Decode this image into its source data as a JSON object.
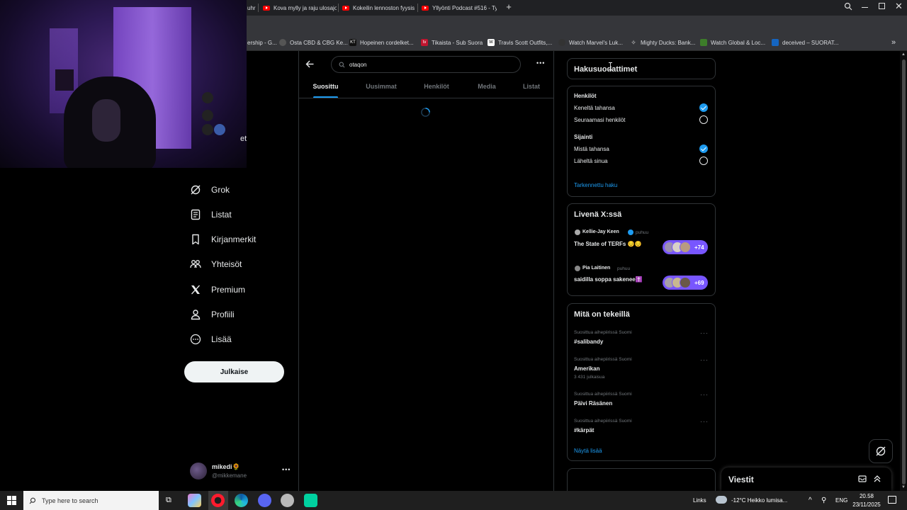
{
  "browser": {
    "tabs": [
      {
        "label": "uhr"
      },
      {
        "label": "Kova mylly ja raju ulosajo"
      },
      {
        "label": "Kokeilin lennoston fyysis"
      },
      {
        "label": "Yllyönti Podcast #516 - Ty"
      }
    ],
    "new_tab_icon": "plus-icon",
    "bookmarks": [
      {
        "label": "ership - G..."
      },
      {
        "label": "Osta CBD & CBG Ke..."
      },
      {
        "label": "Hopeinen cordelket..."
      },
      {
        "label": "Tikaista - Sub Suora"
      },
      {
        "label": "Travis Scott Outfits,..."
      },
      {
        "label": "Watch Marvel's Luk..."
      },
      {
        "label": "Mighty Ducks: Bank..."
      },
      {
        "label": "Watch Global & Loc..."
      },
      {
        "label": "deceived – SUORAT..."
      }
    ]
  },
  "webcam": {
    "partial_text": "et"
  },
  "nav": {
    "items": [
      {
        "label": "Grok",
        "icon": "grok-icon"
      },
      {
        "label": "Listat",
        "icon": "list-icon"
      },
      {
        "label": "Kirjanmerkit",
        "icon": "bookmark-icon"
      },
      {
        "label": "Yhteisöt",
        "icon": "communities-icon"
      },
      {
        "label": "Premium",
        "icon": "x-logo-icon"
      },
      {
        "label": "Profiili",
        "icon": "profile-icon"
      },
      {
        "label": "Lisää",
        "icon": "more-circle-icon"
      }
    ],
    "publish_label": "Julkaise",
    "account": {
      "name": "mikedi🌻",
      "handle": "@mikkemane"
    }
  },
  "center": {
    "search_value": "otaqon",
    "tabs": [
      {
        "label": "Suosittu",
        "active": true
      },
      {
        "label": "Uusimmat",
        "active": false
      },
      {
        "label": "Henkilöt",
        "active": false
      },
      {
        "label": "Media",
        "active": false
      },
      {
        "label": "Listat",
        "active": false
      }
    ]
  },
  "filters": {
    "title": "Hakusuodattimet",
    "people_heading": "Henkilöt",
    "people_options": [
      {
        "label": "Keneltä tahansa",
        "selected": true
      },
      {
        "label": "Seuraamasi henkilöt",
        "selected": false
      }
    ],
    "location_heading": "Sijainti",
    "location_options": [
      {
        "label": "Mistä tahansa",
        "selected": true
      },
      {
        "label": "Läheltä sinua",
        "selected": false
      }
    ],
    "advanced_link": "Tarkennettu haku"
  },
  "live": {
    "title": "Livenä X:ssä",
    "spaces": [
      {
        "host": "Kellie-Jay Keen",
        "verb": "puhuu",
        "title": "The State of TERFs 😔😔",
        "count": "+74"
      },
      {
        "host": "Pia Laitinen",
        "verb": "puhuu",
        "title": "saidilla soppa sakenee✝️",
        "count": "+69"
      }
    ]
  },
  "trends": {
    "title": "Mitä on tekeillä",
    "items": [
      {
        "context": "Suosittua aihepiirissä Suomi",
        "name": "#salibandy",
        "posts": ""
      },
      {
        "context": "Suosittua aihepiirissä Suomi",
        "name": "Amerikan",
        "posts": "3 431 julkaisua"
      },
      {
        "context": "Suosittua aihepiirissä Suomi",
        "name": "Päivi Räsänen",
        "posts": ""
      },
      {
        "context": "Suosittua aihepiirissä Suomi",
        "name": "#kärpät",
        "posts": ""
      }
    ],
    "show_more": "Näytä lisää"
  },
  "messages": {
    "title": "Viestit"
  },
  "taskbar": {
    "search_placeholder": "Type here to search",
    "links_label": "Links",
    "weather": "-12°C  Heikko lumisa...",
    "lang": "ENG",
    "time": "20.58",
    "date": "23/11/2025"
  },
  "colors": {
    "accent": "#1d9bf0",
    "spaces_purple": "#7856ff",
    "background": "#000000"
  }
}
